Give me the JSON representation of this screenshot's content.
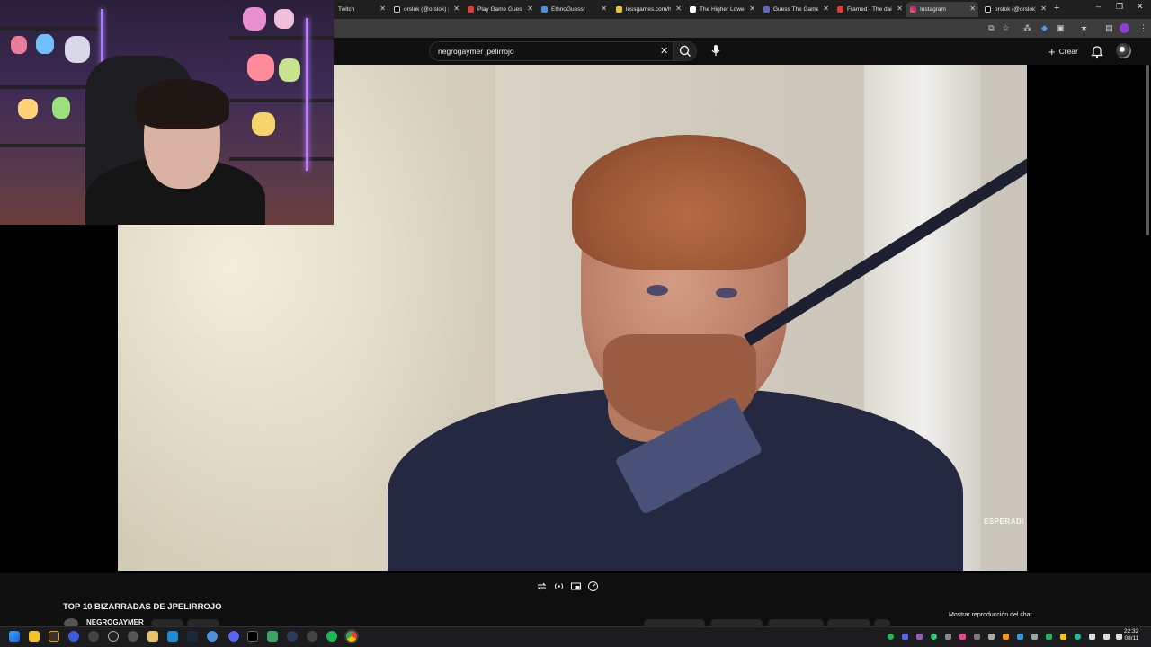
{
  "browser": {
    "tabs": [
      {
        "label": "Twitch",
        "color": "#9146ff"
      },
      {
        "label": "orslok (@orslok) | TikTok",
        "color": "#ffffff"
      },
      {
        "label": "Play Game Guesser",
        "color": "#e53935"
      },
      {
        "label": "EthnoGuessr",
        "color": "#4a90d9"
      },
      {
        "label": "lessgames.com/higher",
        "color": "#f4c430"
      },
      {
        "label": "The Higher Lower Game",
        "color": "#ffffff"
      },
      {
        "label": "Guess The Game",
        "color": "#5c6bc0"
      },
      {
        "label": "Framed - The daily movie",
        "color": "#e53935"
      },
      {
        "label": "Instagram",
        "color": "#e1306c"
      },
      {
        "label": "orslok (@orslok) | TikTok",
        "color": "#ffffff"
      }
    ],
    "new_tab": "+",
    "window_controls": {
      "minimize": "–",
      "restore": "❐",
      "close": "✕"
    }
  },
  "youtube": {
    "search": {
      "value": "negrogaymer jpelirrojo",
      "clear": "✕"
    },
    "create_label": "Crear",
    "create_plus": "+",
    "video": {
      "watermark": "ESPERADI",
      "title": "TOP 10 BIZARRADAS DE JPELIRROJO",
      "channel": "NEGROGAYMER"
    },
    "chat_link": "Mostrar reproducción del chat"
  },
  "taskbar": {
    "time": "22:32",
    "date": "08/11",
    "icons": [
      "windows",
      "file-explorer",
      "search",
      "vivaldi",
      "epic",
      "obs",
      "voicemeeter",
      "steam",
      "app",
      "discord",
      "tiktok",
      "ccleaner",
      "app",
      "chrome",
      "spotify",
      "chrome"
    ]
  }
}
